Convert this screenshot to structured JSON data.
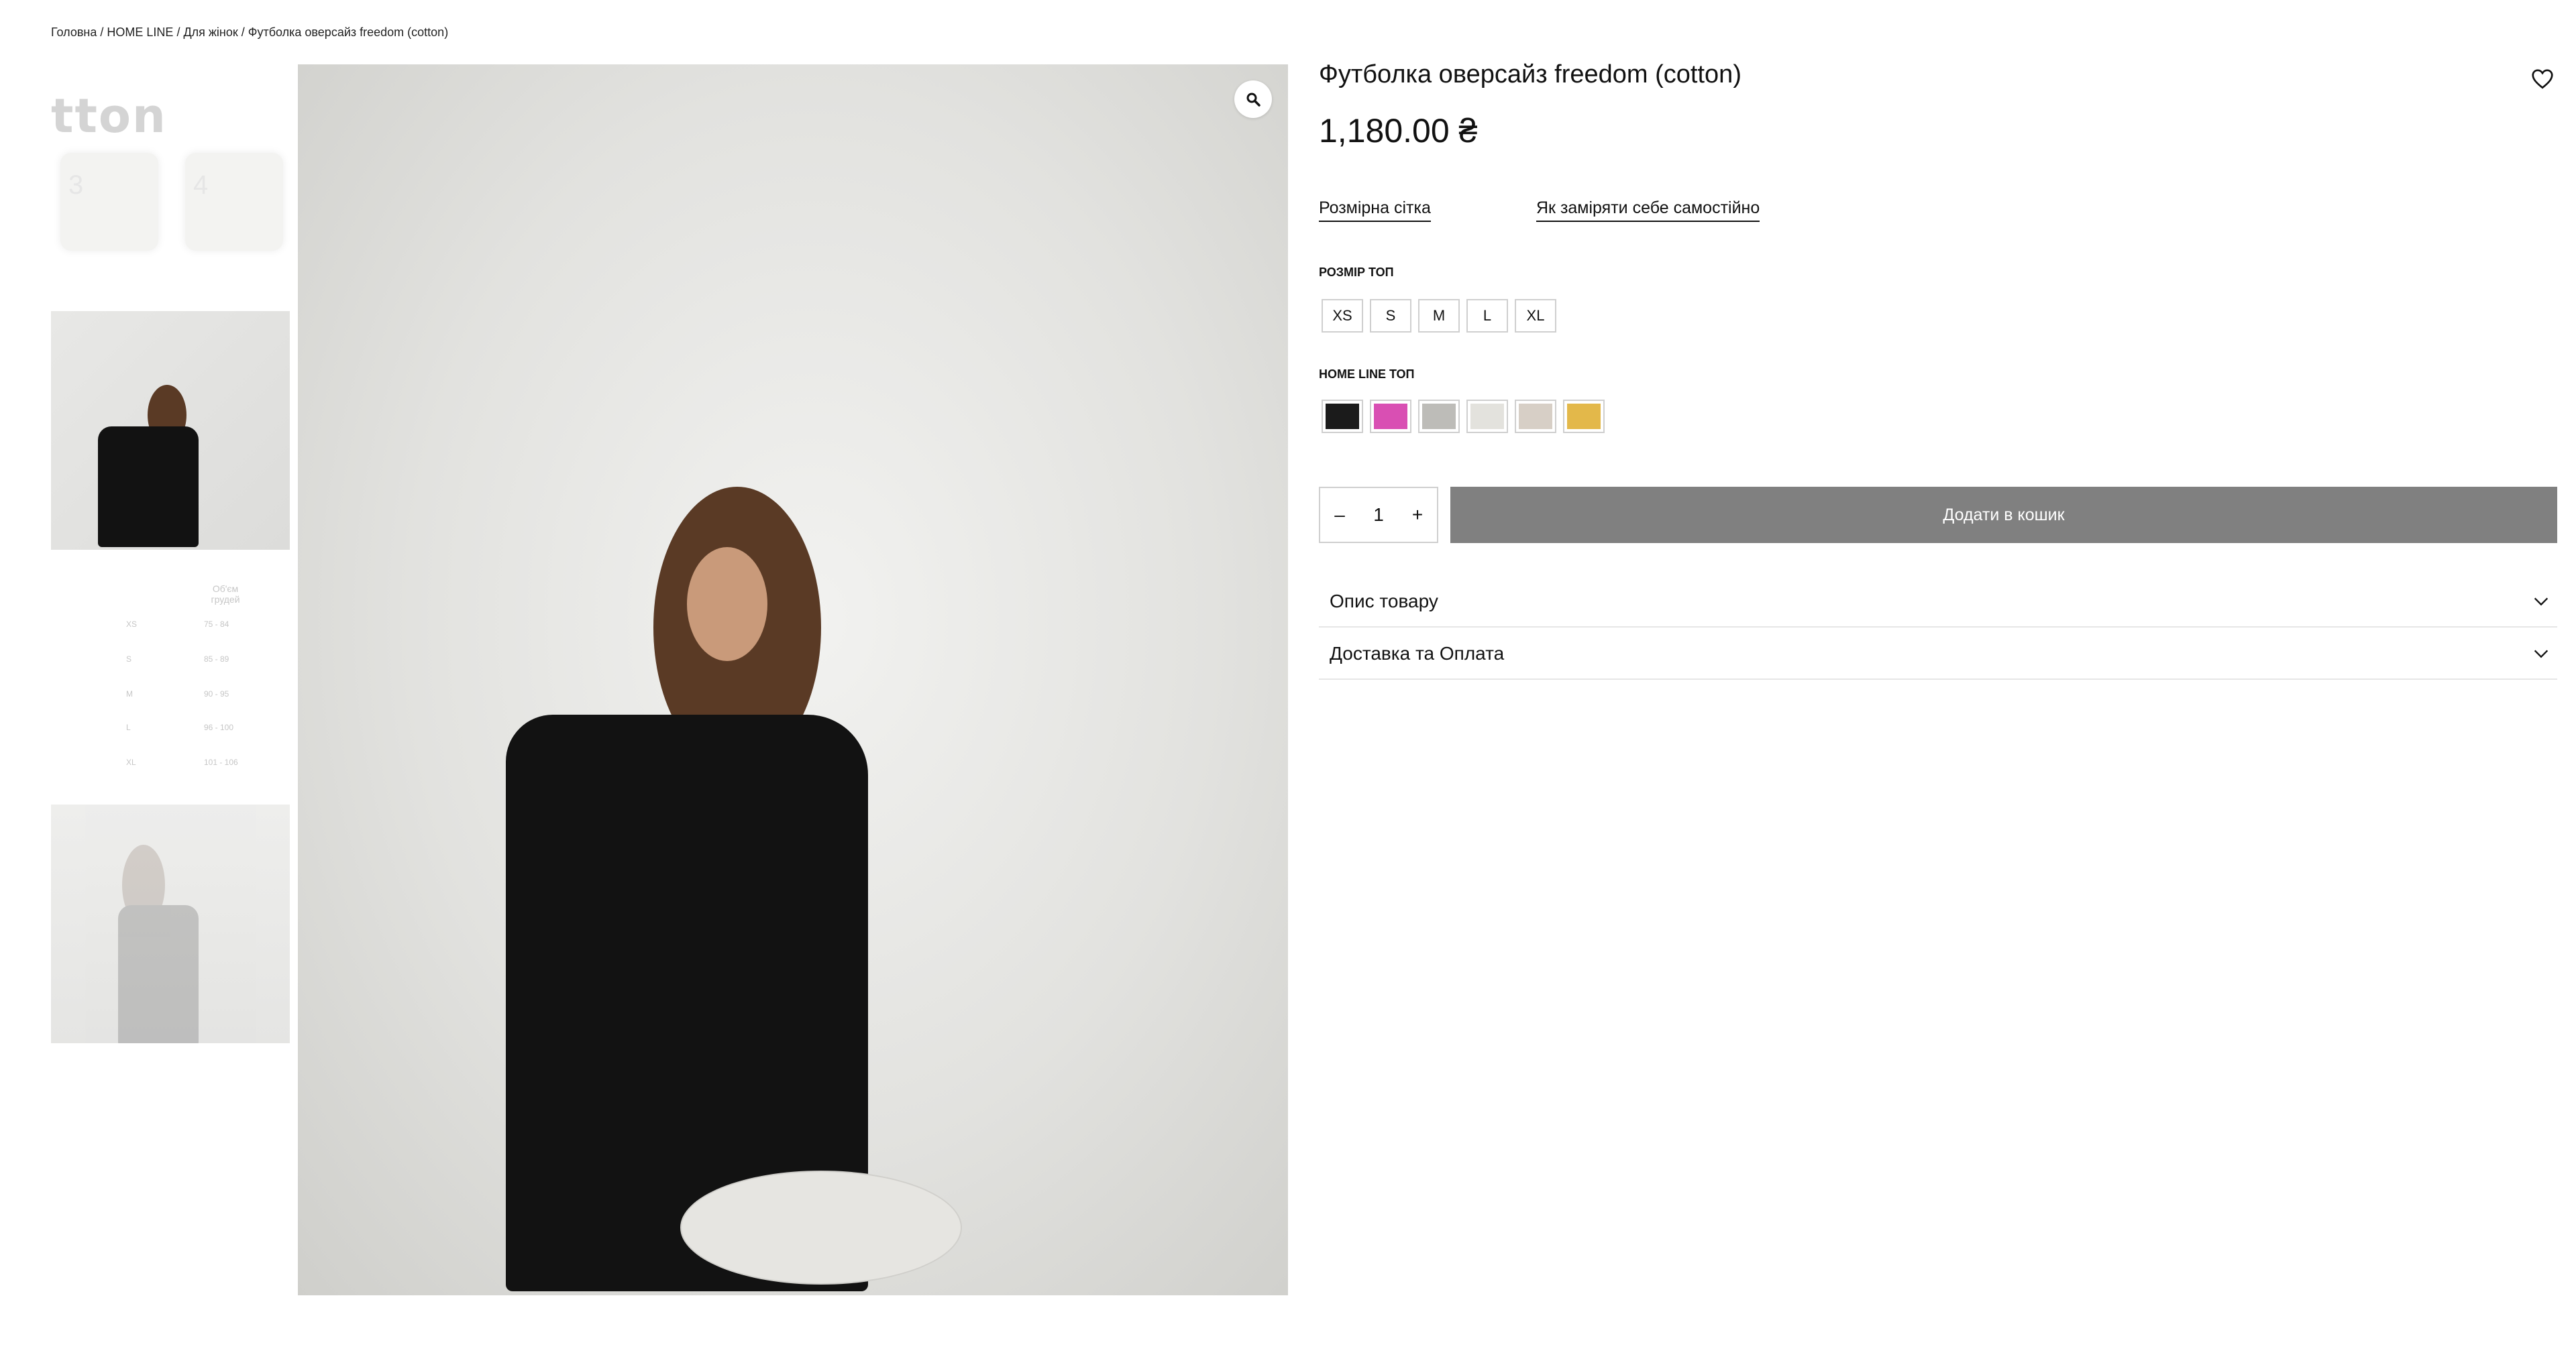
{
  "breadcrumb": {
    "home": "Головна",
    "sep1": " / ",
    "category": "HOME LINE",
    "sep2": " / ",
    "subcategory": "Для жінок",
    "sep3": " / ",
    "current": "Футболка оверсайз freedom (cotton)"
  },
  "gallery": {
    "logo_text": "tton",
    "logo_sq1": "3",
    "logo_sq2": "4",
    "size_table": {
      "header": "Об'єм грудей",
      "rows": [
        {
          "size": "XS",
          "range": "75 - 84"
        },
        {
          "size": "S",
          "range": "85 - 89"
        },
        {
          "size": "M",
          "range": "90 - 95"
        },
        {
          "size": "L",
          "range": "96 - 100"
        },
        {
          "size": "XL",
          "range": "101 - 106"
        }
      ]
    },
    "zoom_icon": "magnifier-icon"
  },
  "product": {
    "title": "Футболка оверсайз freedom (cotton)",
    "price": "1,180.00 ₴",
    "size_chart_link": "Розмірна сітка",
    "measure_link": "Як заміряти себе самостійно",
    "size_label": "РОЗМІР ТОП",
    "sizes": [
      "XS",
      "S",
      "M",
      "L",
      "XL"
    ],
    "color_label": "HOME LINE ТОП",
    "colors": [
      "#1b1b1b",
      "#d94fb3",
      "#bdbcb8",
      "#e3e2dd",
      "#d7cfc6",
      "#e3b84a"
    ],
    "qty_minus": "–",
    "qty_value": "1",
    "qty_plus": "+",
    "add_to_cart": "Додати в кошик",
    "accordion": [
      {
        "label": "Опис товару"
      },
      {
        "label": "Доставка та Оплата"
      }
    ],
    "wishlist_icon": "heart-icon"
  }
}
